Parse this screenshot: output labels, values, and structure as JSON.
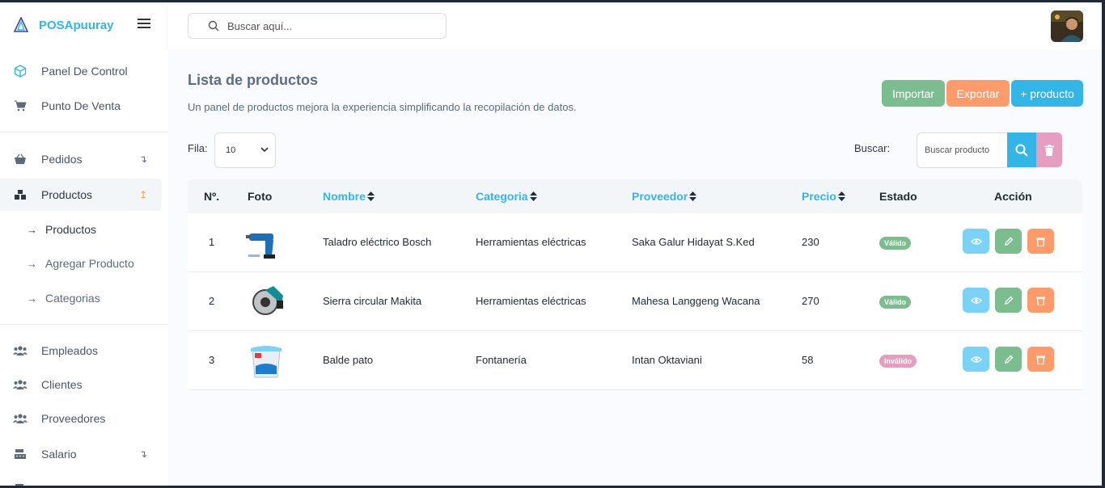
{
  "app": {
    "brand": "POSApuuray"
  },
  "header": {
    "search_placeholder": "Buscar aquí..."
  },
  "sidebar": {
    "items": [
      {
        "label": "Panel De Control"
      },
      {
        "label": "Punto De Venta"
      },
      {
        "label": "Pedidos",
        "arrow": "↴"
      },
      {
        "label": "Productos",
        "arrow": "↥"
      },
      {
        "label": "Empleados"
      },
      {
        "label": "Clientes"
      },
      {
        "label": "Proveedores"
      },
      {
        "label": "Salario",
        "arrow": "↴"
      }
    ],
    "sub_items": [
      {
        "label": "Productos"
      },
      {
        "label": "Agregar Producto"
      },
      {
        "label": "Categorias"
      }
    ]
  },
  "page": {
    "title": "Lista de productos",
    "subtitle": "Un panel de productos mejora la experiencia simplificando la recopilación de datos.",
    "buttons": {
      "import": "Importar",
      "export": "Exportar",
      "add": "+ producto"
    },
    "rows_label": "Fila:",
    "rows_value": "10",
    "search_label": "Buscar:",
    "search_placeholder": "Buscar producto"
  },
  "table": {
    "headers": {
      "no": "Nº.",
      "photo": "Foto",
      "name": "Nombre",
      "category": "Categoria",
      "supplier": "Proveedor",
      "price": "Precio",
      "status": "Estado",
      "action": "Acción"
    },
    "rows": [
      {
        "no": "1",
        "name": "Taladro eléctrico Bosch",
        "category": "Herramientas eléctricas",
        "supplier": "Saka Galur Hidayat S.Ked",
        "price": "230",
        "status": "Válido",
        "status_color": "#7cbd8f"
      },
      {
        "no": "2",
        "name": "Sierra circular Makita",
        "category": "Herramientas eléctricas",
        "supplier": "Mahesa Langgeng Wacana",
        "price": "270",
        "status": "Válido",
        "status_color": "#7cbd8f"
      },
      {
        "no": "3",
        "name": "Balde pato",
        "category": "Fontanería",
        "supplier": "Intan Oktaviani",
        "price": "58",
        "status": "Inválido",
        "status_color": "#e59dc0"
      }
    ]
  },
  "colors": {
    "primary": "#33b6e6",
    "success": "#7cbd8f",
    "orange": "#fd9b6b",
    "pink": "#e59dc0"
  }
}
